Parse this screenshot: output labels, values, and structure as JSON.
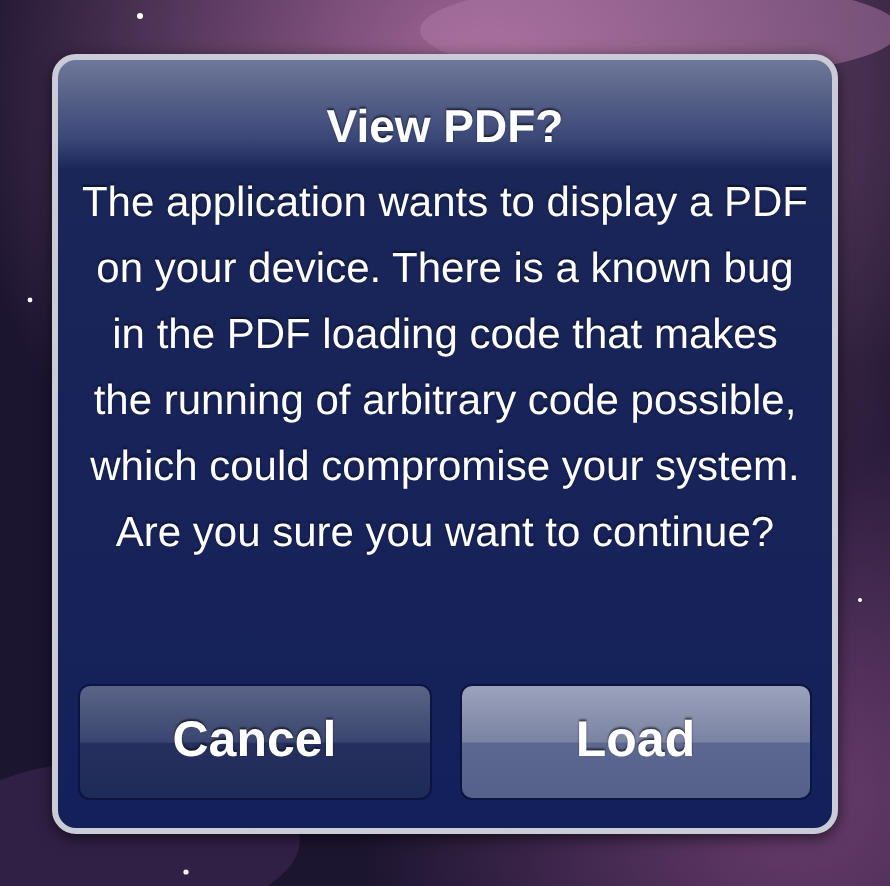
{
  "alert": {
    "title": "View PDF?",
    "message": "The application wants to display a PDF on your device. There is a known bug in the PDF loading code that makes the running of arbitrary code possible, which could compromise your system. Are you sure you want to continue?"
  },
  "buttons": [
    {
      "label": "Cancel",
      "kind": "cancel"
    },
    {
      "label": "Load",
      "kind": "default"
    }
  ]
}
